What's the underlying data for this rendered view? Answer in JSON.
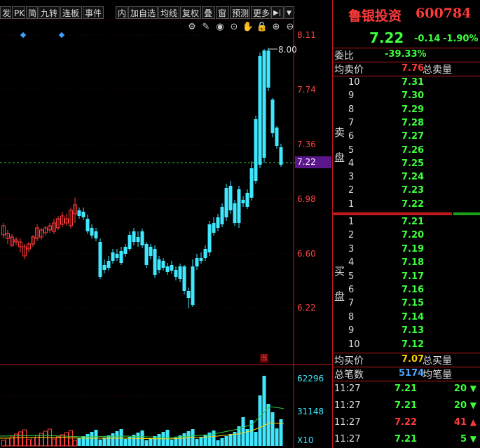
{
  "toolbar": {
    "items": [
      "发",
      "PK",
      "简",
      "九转",
      "连板",
      "事件",
      "内",
      "加自选",
      "均线",
      "复权",
      "叠",
      "窗",
      "预测",
      "更多"
    ],
    "arrow_right": "▶|",
    "dropdown": "▼"
  },
  "chart": {
    "price_labels": [
      "8.11",
      "7.74",
      "7.36",
      "6.98",
      "6.60",
      "6.22"
    ],
    "current_label": "7.22",
    "max_label": "8.00",
    "limit_up_mark": "涨",
    "volume_labels": [
      "62296",
      "31148",
      "X10"
    ]
  },
  "stock": {
    "name": "鲁银投资",
    "code": "600784",
    "price": "7.22",
    "change": "-0.14",
    "change_pct": "-1.90%"
  },
  "order_book": {
    "weibi_label": "委比",
    "weibi_value": "-39.33%",
    "avg_sell_label": "均卖价",
    "avg_sell_value": "7.76",
    "total_sell_label": "总卖量",
    "sell_side_label": [
      "卖",
      "盘"
    ],
    "sells": [
      {
        "level": "10",
        "price": "7.31"
      },
      {
        "level": "9",
        "price": "7.30"
      },
      {
        "level": "8",
        "price": "7.29"
      },
      {
        "level": "7",
        "price": "7.28"
      },
      {
        "level": "6",
        "price": "7.27"
      },
      {
        "level": "5",
        "price": "7.26"
      },
      {
        "level": "4",
        "price": "7.25"
      },
      {
        "level": "3",
        "price": "7.24"
      },
      {
        "level": "2",
        "price": "7.23"
      },
      {
        "level": "1",
        "price": "7.22"
      }
    ],
    "buy_side_label": [
      "买",
      "盘"
    ],
    "buys": [
      {
        "level": "1",
        "price": "7.21"
      },
      {
        "level": "2",
        "price": "7.20"
      },
      {
        "level": "3",
        "price": "7.19"
      },
      {
        "level": "4",
        "price": "7.18"
      },
      {
        "level": "5",
        "price": "7.17"
      },
      {
        "level": "6",
        "price": "7.16"
      },
      {
        "level": "7",
        "price": "7.15"
      },
      {
        "level": "8",
        "price": "7.14"
      },
      {
        "level": "9",
        "price": "7.13"
      },
      {
        "level": "10",
        "price": "7.12"
      }
    ],
    "avg_buy_label": "均买价",
    "avg_buy_value": "7.07",
    "total_buy_label": "总买量",
    "total_trades_label": "总笔数",
    "total_trades_value": "5174",
    "avg_trade_label": "均笔量"
  },
  "ticks": [
    {
      "time": "11:27",
      "price": "7.21",
      "vol": "20",
      "dir": "down"
    },
    {
      "time": "11:27",
      "price": "7.21",
      "vol": "20",
      "dir": "down"
    },
    {
      "time": "11:27",
      "price": "7.22",
      "vol": "41",
      "dir": "up"
    },
    {
      "time": "11:27",
      "price": "7.21",
      "vol": "5",
      "dir": "down"
    }
  ],
  "colors": {
    "up": "#ff3a3a",
    "down": "#3fe8ff",
    "accent": "#c0181c",
    "highlight": "#5a168a"
  }
}
